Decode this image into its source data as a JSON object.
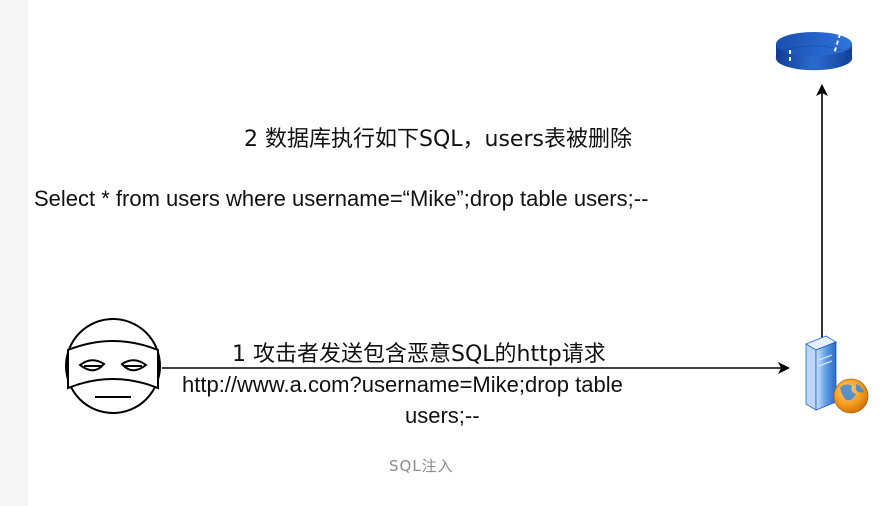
{
  "diagram": {
    "step2_label": "2 数据库执行如下SQL，users表被删除",
    "sql_statement": "Select * from users where username=“Mike”;drop table users;--",
    "step1_label": "1 攻击者发送包含恶意SQL的http请求",
    "url_line1": "http://www.a.com?username=Mike;drop table",
    "url_line2": "users;--",
    "caption": "SQL注入"
  },
  "icons": {
    "attacker": "masked-attacker-icon",
    "server": "web-server-icon",
    "database": "database-icon"
  },
  "colors": {
    "database_blue": "#1f5fc8",
    "server_blue": "#3a7fd6",
    "globe_orange": "#f39a1e"
  }
}
